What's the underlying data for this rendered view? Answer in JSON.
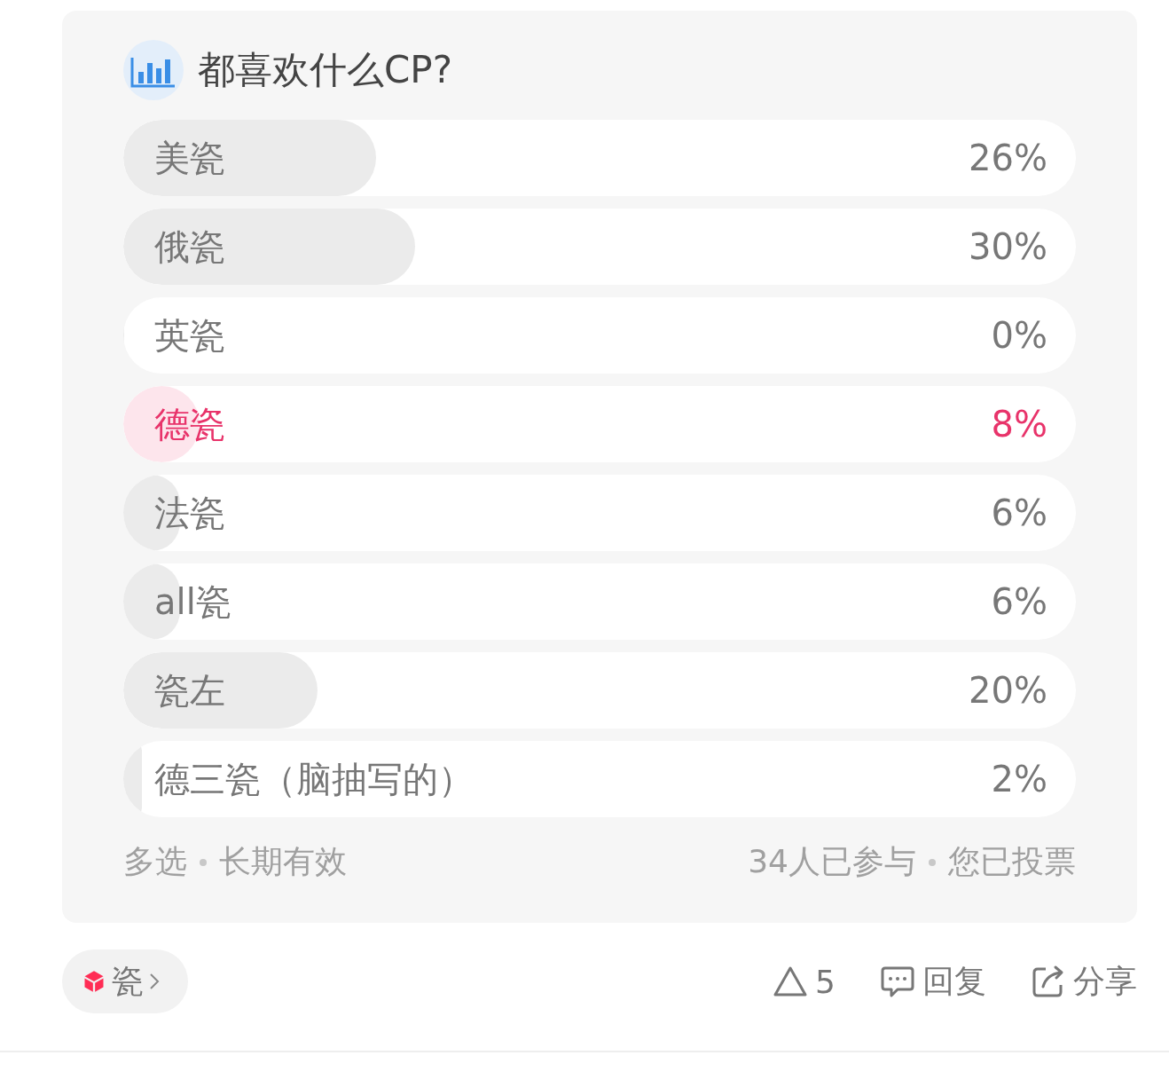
{
  "poll": {
    "title": "都喜欢什么CP?",
    "options": [
      {
        "label": "美瓷",
        "percent": "26%",
        "level": 0.265,
        "selected": false
      },
      {
        "label": "俄瓷",
        "percent": "30%",
        "level": 0.306,
        "selected": false
      },
      {
        "label": "英瓷",
        "percent": "0%",
        "level": 0,
        "selected": false
      },
      {
        "label": "德瓷",
        "percent": "8%",
        "level": 0.08,
        "selected": true
      },
      {
        "label": "法瓷",
        "percent": "6%",
        "level": 0.06,
        "selected": false
      },
      {
        "label": "all瓷",
        "percent": "6%",
        "level": 0.06,
        "selected": false
      },
      {
        "label": "瓷左",
        "percent": "20%",
        "level": 0.204,
        "selected": false
      },
      {
        "label": "德三瓷（脑抽写的）",
        "percent": "2%",
        "level": 0.02,
        "selected": false
      }
    ],
    "footer_left": [
      "多选",
      "长期有效"
    ],
    "footer_right": [
      "34人已参与",
      "您已投票"
    ]
  },
  "tag": {
    "label": "瓷"
  },
  "actions": {
    "likes": "5",
    "reply": "回复",
    "share": "分享"
  }
}
